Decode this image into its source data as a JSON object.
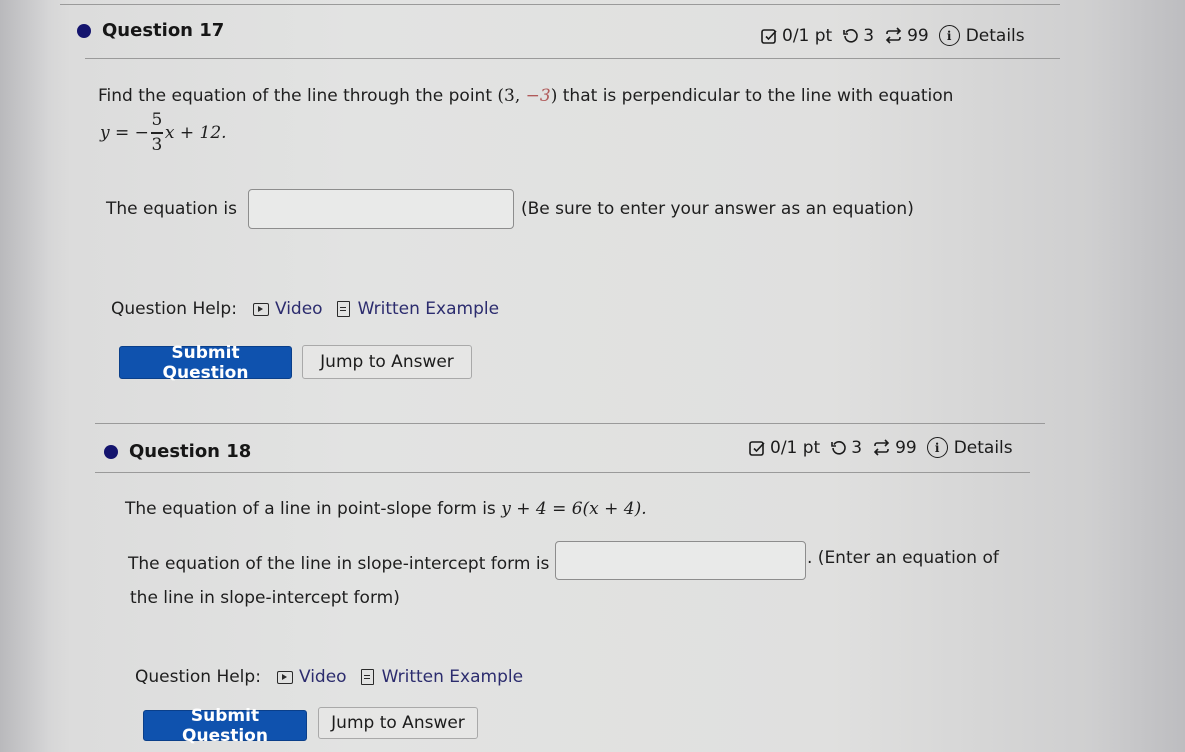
{
  "questions": [
    {
      "title": "Question 17",
      "meta": {
        "score": "0/1 pt",
        "retries": "3",
        "attempts": "99",
        "details_label": "Details"
      },
      "prompt": {
        "prefix": "Find the equation of the line through the point",
        "point_open": "(3, ",
        "point_neg": "−3",
        "point_close": ")",
        "suffix": " that is perpendicular to the line with equation",
        "given_eq": {
          "lhs": "y = −",
          "numerator": "5",
          "denominator": "3",
          "rhs": "x + 12."
        }
      },
      "answer": {
        "label": "The equation is",
        "value": "",
        "hint": "(Be sure to enter your answer as an equation)"
      },
      "help": {
        "label": "Question Help:",
        "video": "Video",
        "written_example": "Written Example"
      },
      "buttons": {
        "submit": "Submit Question",
        "jump": "Jump to Answer"
      }
    },
    {
      "title": "Question 18",
      "meta": {
        "score": "0/1 pt",
        "retries": "3",
        "attempts": "99",
        "details_label": "Details"
      },
      "prompt": {
        "prefix": "The equation of a line in point-slope form is",
        "equation": "y + 4 = 6(x + 4)."
      },
      "answer": {
        "label": "The equation of the line in slope-intercept form is",
        "value": "",
        "hint_line1": ". (Enter an equation of",
        "hint_line2": "the line in slope-intercept form)"
      },
      "help": {
        "label": "Question Help:",
        "video": "Video",
        "written_example": "Written Example"
      },
      "buttons": {
        "submit": "Submit Question",
        "jump": "Jump to Answer"
      }
    }
  ]
}
